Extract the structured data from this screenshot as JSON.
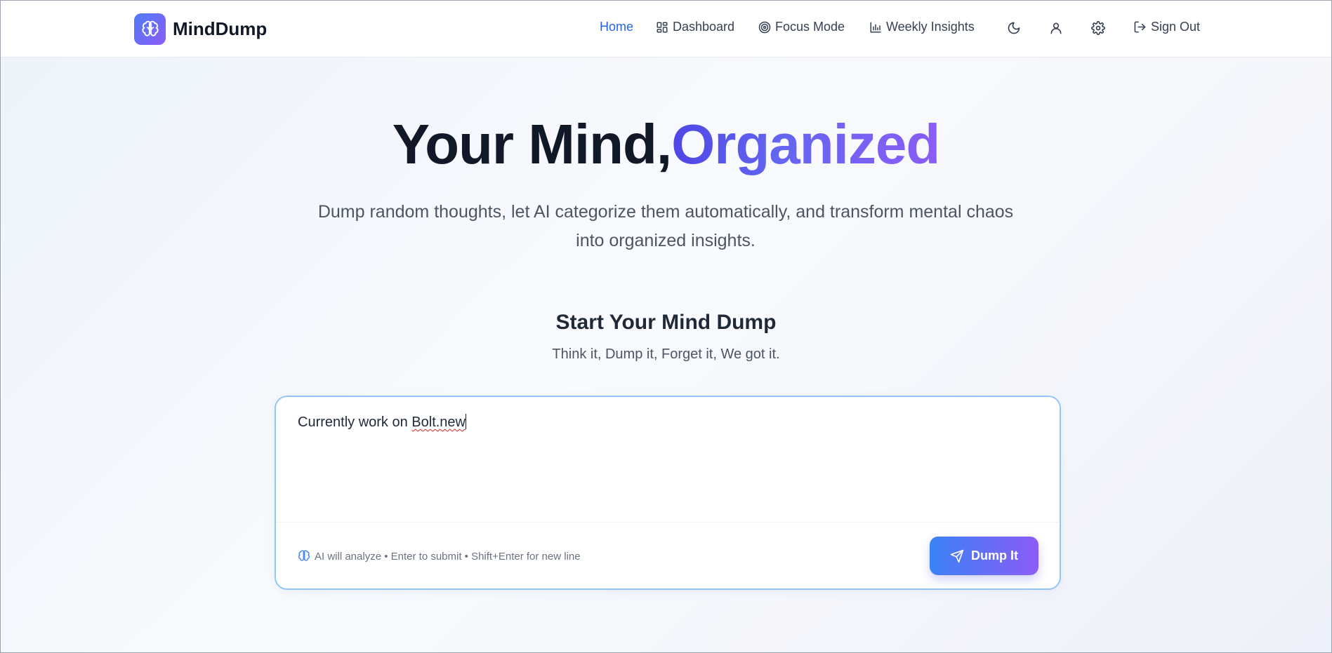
{
  "brand": {
    "name": "MindDump",
    "logo_icon": "brain-icon"
  },
  "nav": {
    "home": "Home",
    "dashboard": "Dashboard",
    "focus_mode": "Focus Mode",
    "weekly_insights": "Weekly Insights",
    "sign_out": "Sign Out",
    "icons": [
      "moon-icon",
      "user-icon",
      "gear-icon"
    ]
  },
  "hero": {
    "title_plain": "Your Mind,",
    "title_accent": "Organized",
    "subtitle": "Dump random thoughts, let AI categorize them automatically, and transform mental chaos into organized insights."
  },
  "dump": {
    "title": "Start Your Mind Dump",
    "subtitle": "Think it, Dump it, Forget it, We got it.",
    "input_prefix": "Currently work on ",
    "input_misspelled": "Bolt.new",
    "hint": "AI will analyze • Enter to submit • Shift+Enter for new line",
    "button_label": "Dump It"
  },
  "colors": {
    "accent": "#2563eb",
    "gradient_start": "#3b82f6",
    "gradient_end": "#8b5cf6",
    "card_border": "#93c5fd"
  }
}
